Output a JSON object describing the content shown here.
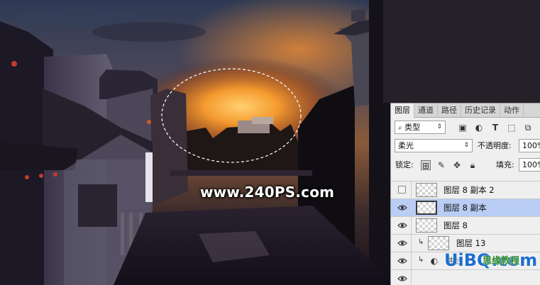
{
  "watermark": {
    "site": "www.240PS.com",
    "corner_brand": "UiBQ.com",
    "corner_brand_cn": "思缘教程"
  },
  "panel": {
    "tabs": [
      {
        "label": "图层",
        "active": true
      },
      {
        "label": "通道",
        "active": false
      },
      {
        "label": "路径",
        "active": false
      },
      {
        "label": "历史记录",
        "active": false
      },
      {
        "label": "动作",
        "active": false
      }
    ],
    "filter_kind": "类型",
    "blend_mode": "柔光",
    "opacity_label": "不透明度:",
    "opacity_value": "100%",
    "lock_label": "锁定:",
    "fill_label": "填充:",
    "fill_value": "100%",
    "layers": [
      {
        "name": "图层 8 副本 2",
        "visible": false,
        "selected": false,
        "clipped": false
      },
      {
        "name": "图层 8 副本",
        "visible": true,
        "selected": true,
        "clipped": false
      },
      {
        "name": "图层 8",
        "visible": true,
        "selected": false,
        "clipped": false
      },
      {
        "name": "图层 13",
        "visible": true,
        "selected": false,
        "clipped": true
      },
      {
        "name": "曲线",
        "visible": true,
        "selected": false,
        "clipped": true
      }
    ]
  },
  "colors": {
    "selected_layer": "#b9cdf5",
    "panel_bg": "#efefef",
    "sunset_core": "#ffb545"
  }
}
